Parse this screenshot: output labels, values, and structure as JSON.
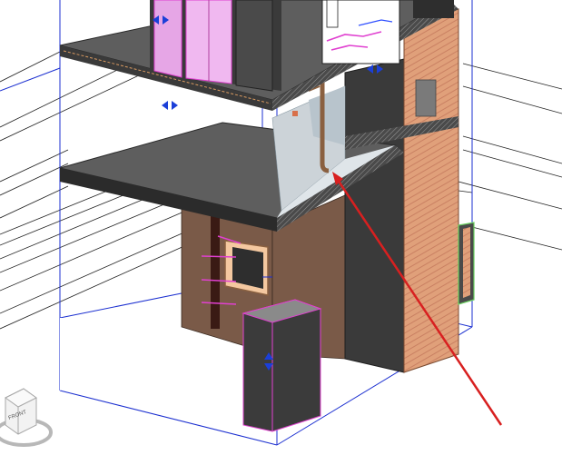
{
  "view": {
    "type": "3D view",
    "background": "#ffffff"
  },
  "viewcube": {
    "face_label": "FRONT"
  },
  "colors": {
    "slab_top": "#5e5e5e",
    "slab_edge": "#3a3a3a",
    "wall_brown": "#7a5a48",
    "wall_wood": "#d9926a",
    "dark_box": "#3b3b3b",
    "floor_light": "#ccd3d8",
    "pipe": "#8a6040",
    "magenta": "#e040d0",
    "blue_line": "#1b2fd0",
    "annotation_arrow": "#d82020"
  },
  "controls": {
    "flip_arrow_icon": "double-arrow-icon"
  },
  "annotation": {
    "type": "arrow"
  }
}
